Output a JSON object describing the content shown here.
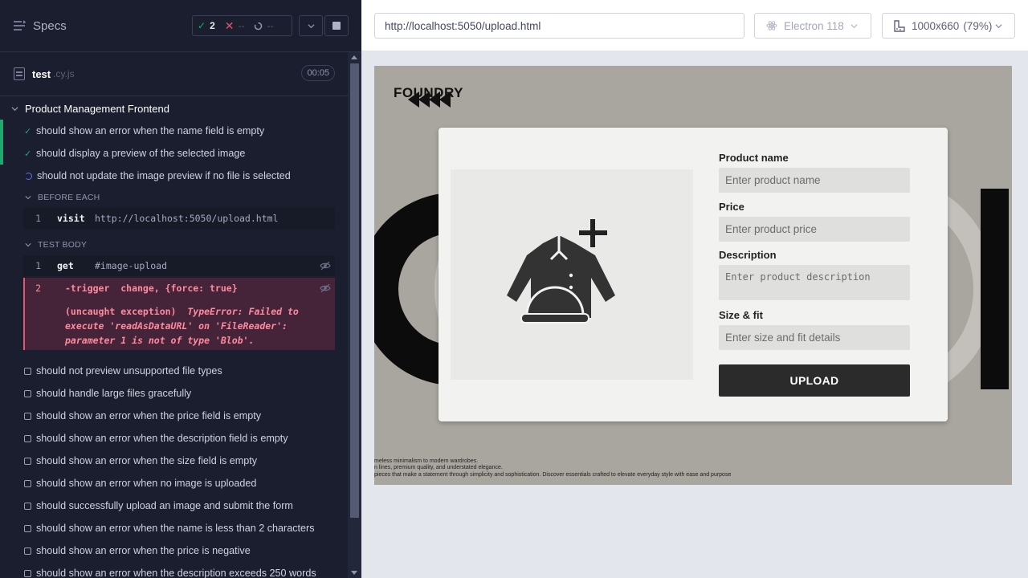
{
  "reporter": {
    "header": {
      "specs_label": "Specs"
    },
    "stats": {
      "passed": "2",
      "failed": "--",
      "pending": "--"
    },
    "spec": {
      "name": "test",
      "ext": ".cy.js",
      "duration": "00:05"
    },
    "suite": {
      "title": "Product Management Frontend"
    },
    "tests_top": [
      {
        "label": "should show an error when the name field is empty",
        "state": "passed"
      },
      {
        "label": "should display a preview of the selected image",
        "state": "passed"
      },
      {
        "label": "should not update the image preview if no file is selected",
        "state": "running"
      }
    ],
    "before_each": {
      "label": "BEFORE EACH",
      "commands": [
        {
          "num": "1",
          "name": "visit",
          "arg": "http://localhost:5050/upload.html"
        }
      ]
    },
    "test_body": {
      "label": "TEST BODY",
      "commands": [
        {
          "num": "1",
          "name": "get",
          "arg": "#image-upload"
        }
      ],
      "error_command": {
        "num": "2",
        "text": "-trigger  change, {force: true}"
      },
      "error_prefix": "(uncaught exception)",
      "error_type": "TypeError:",
      "error_message": "Failed to execute 'readAsDataURL' on 'FileReader': parameter 1 is not of type 'Blob'."
    },
    "tests_pending": [
      "should not preview unsupported file types",
      "should handle large files gracefully",
      "should show an error when the price field is empty",
      "should show an error when the description field is empty",
      "should show an error when the size field is empty",
      "should show an error when no image is uploaded",
      "should successfully upload an image and submit the form",
      "should show an error when the name is less than 2 characters",
      "should show an error when the price is negative",
      "should show an error when the description exceeds 250 words"
    ]
  },
  "toolbar": {
    "url": "http://localhost:5050/upload.html",
    "browser": "Electron 118",
    "viewport": "1000x660",
    "zoom": "(79%)"
  },
  "app": {
    "logo": "FOUNDRY",
    "form": {
      "name_label": "Product name",
      "name_placeholder": "Enter product name",
      "price_label": "Price",
      "price_placeholder": "Enter product price",
      "description_label": "Description",
      "description_placeholder": "Enter product description",
      "size_label": "Size & fit",
      "size_placeholder": "Enter size and fit details",
      "submit_label": "UPLOAD"
    },
    "footer_lines": [
      "meless minimalism to modern wardrobes.",
      "n lines, premium quality, and understated elegance.",
      "pieces that make a statement through simplicity and sophistication. Discover essentials crafted to elevate everyday style with ease and purpose"
    ]
  },
  "colors": {
    "pass": "#1fa971",
    "fail": "#e45770",
    "reporter_bg": "#1b1e2e",
    "running": "#6470f3"
  }
}
